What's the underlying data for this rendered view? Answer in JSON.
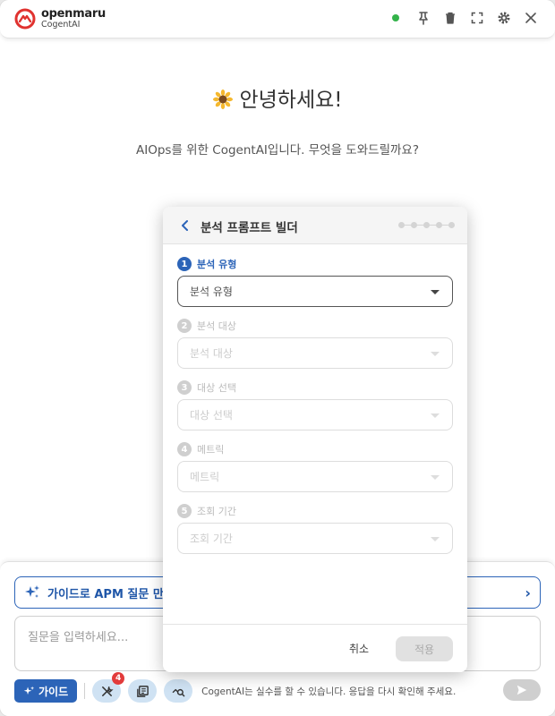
{
  "app": {
    "brand": "openmaru",
    "product": "CogentAI"
  },
  "header": {
    "status_color": "#33b34a",
    "icons": [
      "status-dot",
      "pin-icon",
      "trash-icon",
      "fullscreen-icon",
      "gear-icon",
      "close-icon"
    ]
  },
  "welcome": {
    "emoji": "sunflower",
    "greeting": "안녕하세요!",
    "subtitle": "AIOps를 위한 CogentAI입니다. 무엇을 도와드릴까요?"
  },
  "guide_banner": {
    "label": "가이드로 APM 질문 만들"
  },
  "input": {
    "placeholder": "질문을 입력하세요..."
  },
  "toolbar": {
    "guide_label": "가이드",
    "tools_badge": "4",
    "disclaimer": "CogentAI는 실수를 할 수 있습니다. 응답을 다시 확인해 주세요."
  },
  "modal": {
    "title": "분석 프롬프트 빌더",
    "step_count": 5,
    "fields": [
      {
        "num": "1",
        "label": "분석 유형",
        "placeholder": "분석 유형",
        "active": true
      },
      {
        "num": "2",
        "label": "분석 대상",
        "placeholder": "분석 대상",
        "active": false
      },
      {
        "num": "3",
        "label": "대상 선택",
        "placeholder": "대상 선택",
        "active": false
      },
      {
        "num": "4",
        "label": "메트릭",
        "placeholder": "메트릭",
        "active": false
      },
      {
        "num": "5",
        "label": "조회 기간",
        "placeholder": "조회 기간",
        "active": false
      }
    ],
    "cancel_label": "취소",
    "apply_label": "적용"
  },
  "colors": {
    "accent": "#2c64b8",
    "badge": "#e23b3b"
  }
}
